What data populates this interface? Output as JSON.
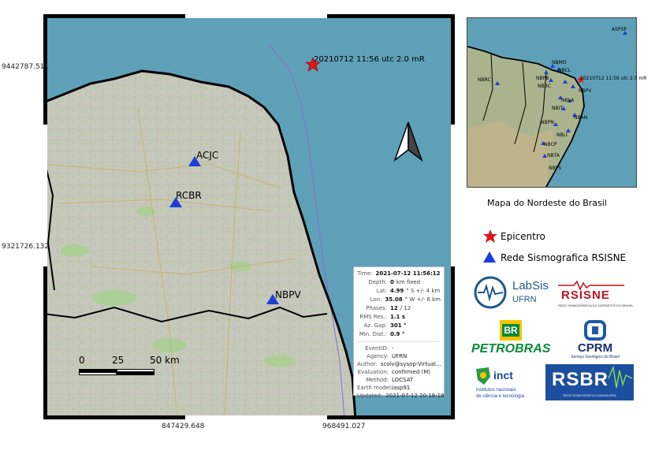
{
  "map": {
    "y_coords": [
      "9442787.511",
      "9321726.132"
    ],
    "x_coords": [
      "847429.648",
      "968491.027"
    ],
    "event_label": "20210712 11:56 utc  2.0 mR",
    "stations": [
      {
        "name": "ACJC"
      },
      {
        "name": "RCBR"
      },
      {
        "name": "NBPV"
      }
    ],
    "scale": {
      "labels": [
        "0",
        "25",
        "50 km"
      ]
    },
    "colors": {
      "sea": "#5ea0b8",
      "land": "#c9c9bd",
      "station": "#1d3fd6",
      "epicenter": "#e0141a",
      "border": "#000000"
    }
  },
  "info": {
    "rows": [
      {
        "label": "Time:",
        "value": "2021-07-12 11:56:12",
        "unit": ""
      },
      {
        "label": "Depth:",
        "value": "0",
        "unit": "km  fixed"
      },
      {
        "label": "Lat:",
        "value": "4.99",
        "unit": "° S   +/- 4  km"
      },
      {
        "label": "Lon:",
        "value": "35.08",
        "unit": "° W  +/- 6  km"
      },
      {
        "label": "Phases:",
        "value": "12",
        "unit": "/  12"
      },
      {
        "label": "RMS Res.:",
        "value": "1.1 s",
        "unit": ""
      },
      {
        "label": "Az. Gap:",
        "value": "301 °",
        "unit": ""
      },
      {
        "label": "Min. Dist.:",
        "value": "0.9 °",
        "unit": ""
      }
    ],
    "meta": [
      {
        "label": "EventID:",
        "value": "-"
      },
      {
        "label": "Agency:",
        "value": "UFRN"
      },
      {
        "label": "Author:",
        "value": "scolv@sysop-Virtual..."
      },
      {
        "label": "Evaluation:",
        "value": "confirmed (M)"
      },
      {
        "label": "Method:",
        "value": "LOCSAT"
      },
      {
        "label": "Earth model:",
        "value": "iasp91"
      },
      {
        "label": "Updated:",
        "value": "2021-07-12 20:18:18"
      }
    ]
  },
  "inset": {
    "caption": "Mapa do Nordeste do Brasil",
    "event_label": "20210712 11:56 utc  2.0 mR",
    "stations": [
      "ASPSP",
      "NBMO",
      "NBRC",
      "NBPB",
      "NBCL",
      "NBBC",
      "NBPV",
      "NBLA",
      "NBIT",
      "NBPN",
      "NBAN",
      "NBLI",
      "NBCP",
      "NBTA",
      "NBPS"
    ]
  },
  "legend": {
    "epicentro": "Epicentro",
    "rede": "Rede Sismografica RSISNE"
  },
  "logos": {
    "labsis": {
      "name": "LabSis",
      "sub": "UFRN"
    },
    "rsisne": {
      "name": "RSISNE",
      "sub": "REDE SISMOGRÁFICA DO NORDESTE DO BRASIL"
    },
    "petrobras": {
      "br": "BR",
      "name": "PETROBRAS"
    },
    "cprm": {
      "name": "CPRM",
      "sub": "Serviço Geológico do Brasil"
    },
    "inct": {
      "name": "inct",
      "sub1": "institutos nacionais",
      "sub2": "de ciência e tecnologia"
    },
    "rsbr": {
      "name": "RSBR",
      "sub": "REDE SISMOGRÁFICA BRASILEIRA"
    }
  }
}
